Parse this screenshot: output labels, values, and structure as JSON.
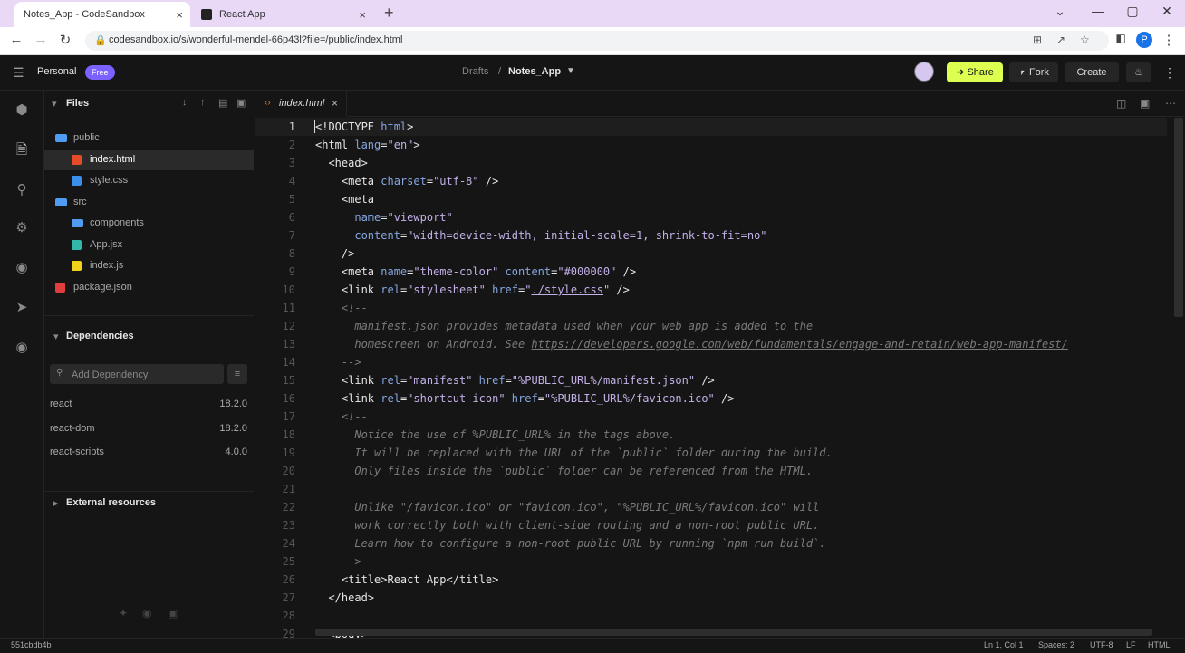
{
  "browser": {
    "tabs": [
      {
        "title": "Notes_App - CodeSandbox",
        "close": "×"
      },
      {
        "title": "React App",
        "close": "×"
      }
    ],
    "new_tab": "+",
    "window_controls": {
      "chevron": "⌄",
      "minimize": "—",
      "restore": "▢",
      "close": "✕"
    },
    "nav": {
      "back": "←",
      "forward": "→",
      "reload": "↻"
    },
    "url": "codesandbox.io/s/wonderful-mendel-66p43l?file=/public/index.html",
    "profile_initial": "P",
    "menu": "⋮"
  },
  "header": {
    "workspace": "Personal",
    "badge": "Free",
    "breadcrumb_root": "Drafts",
    "breadcrumb_sep": "/",
    "project": "Notes_App",
    "share_label": "Share",
    "fork_label": "Fork",
    "create_label": "Create"
  },
  "sidebar": {
    "files_title": "Files",
    "tree": [
      {
        "name": "public",
        "type": "folder"
      },
      {
        "name": "index.html",
        "type": "html"
      },
      {
        "name": "style.css",
        "type": "css"
      },
      {
        "name": "src",
        "type": "folder"
      },
      {
        "name": "components",
        "type": "folder"
      },
      {
        "name": "App.jsx",
        "type": "jsx"
      },
      {
        "name": "index.js",
        "type": "js"
      },
      {
        "name": "package.json",
        "type": "json"
      }
    ],
    "deps_title": "Dependencies",
    "deps_placeholder": "Add Dependency",
    "deps": [
      {
        "name": "react",
        "version": "18.2.0"
      },
      {
        "name": "react-dom",
        "version": "18.2.0"
      },
      {
        "name": "react-scripts",
        "version": "4.0.0"
      }
    ],
    "external_title": "External resources"
  },
  "editor": {
    "tab_name": "index.html",
    "tab_close": "×",
    "lines": [
      [
        [
          "<!DOCTYPE ",
          "tag"
        ],
        [
          "html",
          "attr"
        ],
        [
          ">",
          "tag"
        ]
      ],
      [
        [
          "<html ",
          "tag"
        ],
        [
          "lang",
          "attr"
        ],
        [
          "=",
          "tag"
        ],
        [
          "\"en\"",
          "str"
        ],
        [
          ">",
          "tag"
        ]
      ],
      [
        [
          "  <head>",
          "tag"
        ]
      ],
      [
        [
          "    <meta ",
          "tag"
        ],
        [
          "charset",
          "attr"
        ],
        [
          "=",
          "tag"
        ],
        [
          "\"utf-8\"",
          "str"
        ],
        [
          " />",
          "tag"
        ]
      ],
      [
        [
          "    <meta",
          "tag"
        ]
      ],
      [
        [
          "      ",
          "tag"
        ],
        [
          "name",
          "attr"
        ],
        [
          "=",
          "tag"
        ],
        [
          "\"viewport\"",
          "str"
        ]
      ],
      [
        [
          "      ",
          "tag"
        ],
        [
          "content",
          "attr"
        ],
        [
          "=",
          "tag"
        ],
        [
          "\"width=device-width, initial-scale=1, shrink-to-fit=no\"",
          "str"
        ]
      ],
      [
        [
          "    />",
          "tag"
        ]
      ],
      [
        [
          "    <meta ",
          "tag"
        ],
        [
          "name",
          "attr"
        ],
        [
          "=",
          "tag"
        ],
        [
          "\"theme-color\"",
          "str"
        ],
        [
          " ",
          "tag"
        ],
        [
          "content",
          "attr"
        ],
        [
          "=",
          "tag"
        ],
        [
          "\"#000000\"",
          "str"
        ],
        [
          " />",
          "tag"
        ]
      ],
      [
        [
          "    <link ",
          "tag"
        ],
        [
          "rel",
          "attr"
        ],
        [
          "=",
          "tag"
        ],
        [
          "\"stylesheet\"",
          "str"
        ],
        [
          " ",
          "tag"
        ],
        [
          "href",
          "attr"
        ],
        [
          "=",
          "tag"
        ],
        [
          "\"",
          "str"
        ],
        [
          "./style.css",
          "str lnk"
        ],
        [
          "\"",
          "str"
        ],
        [
          " />",
          "tag"
        ]
      ],
      [
        [
          "    <!--",
          "com"
        ]
      ],
      [
        [
          "      manifest.json provides metadata used when your web app is added to the",
          "com"
        ]
      ],
      [
        [
          "      homescreen on Android. See ",
          "com"
        ],
        [
          "https://developers.google.com/web/fundamentals/engage-and-retain/web-app-manifest/",
          "com lnk"
        ]
      ],
      [
        [
          "    -->",
          "com"
        ]
      ],
      [
        [
          "    <link ",
          "tag"
        ],
        [
          "rel",
          "attr"
        ],
        [
          "=",
          "tag"
        ],
        [
          "\"manifest\"",
          "str"
        ],
        [
          " ",
          "tag"
        ],
        [
          "href",
          "attr"
        ],
        [
          "=",
          "tag"
        ],
        [
          "\"%PUBLIC_URL%/manifest.json\"",
          "str"
        ],
        [
          " />",
          "tag"
        ]
      ],
      [
        [
          "    <link ",
          "tag"
        ],
        [
          "rel",
          "attr"
        ],
        [
          "=",
          "tag"
        ],
        [
          "\"shortcut icon\"",
          "str"
        ],
        [
          " ",
          "tag"
        ],
        [
          "href",
          "attr"
        ],
        [
          "=",
          "tag"
        ],
        [
          "\"%PUBLIC_URL%/favicon.ico\"",
          "str"
        ],
        [
          " />",
          "tag"
        ]
      ],
      [
        [
          "    <!--",
          "com"
        ]
      ],
      [
        [
          "      Notice the use of %PUBLIC_URL% in the tags above.",
          "com"
        ]
      ],
      [
        [
          "      It will be replaced with the URL of the `public` folder during the build.",
          "com"
        ]
      ],
      [
        [
          "      Only files inside the `public` folder can be referenced from the HTML.",
          "com"
        ]
      ],
      [
        [
          "",
          "com"
        ]
      ],
      [
        [
          "      Unlike \"/favicon.ico\" or \"favicon.ico\", \"%PUBLIC_URL%/favicon.ico\" will",
          "com"
        ]
      ],
      [
        [
          "      work correctly both with client-side routing and a non-root public URL.",
          "com"
        ]
      ],
      [
        [
          "      Learn how to configure a non-root public URL by running `npm run build`.",
          "com"
        ]
      ],
      [
        [
          "    -->",
          "com"
        ]
      ],
      [
        [
          "    <title>",
          "tag"
        ],
        [
          "React App",
          "tag"
        ],
        [
          "</title>",
          "tag"
        ]
      ],
      [
        [
          "  </head>",
          "tag"
        ]
      ],
      [
        [
          "",
          "tag"
        ]
      ],
      [
        [
          "  <body>",
          "tag"
        ]
      ]
    ]
  },
  "status": {
    "commit": "551cbdb4b",
    "position": "Ln 1, Col 1",
    "spaces": "Spaces: 2",
    "encoding": "UTF-8",
    "eol": "LF",
    "language": "HTML"
  },
  "colors": {
    "share_bg": "#dcff50",
    "badge_bg": "#7b61ff",
    "folder": "#4f9cf2",
    "html_icon": "#e34c26",
    "css_icon": "#3b8eea",
    "jsx_icon": "#31b6a8",
    "js_icon": "#f1d21b",
    "json_icon": "#e03e3e"
  }
}
